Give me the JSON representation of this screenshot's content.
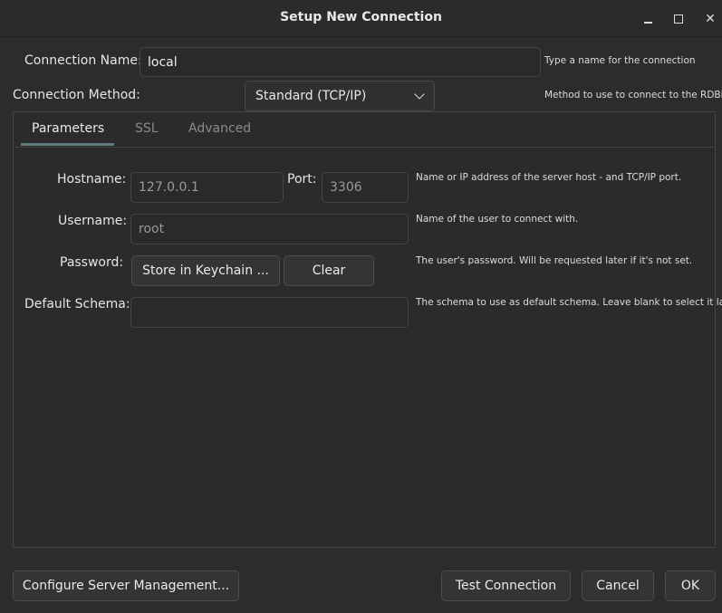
{
  "window": {
    "title": "Setup New Connection",
    "min_icon": "minimize-icon",
    "max_icon": "maximize-icon",
    "close_icon": "close-icon"
  },
  "connection": {
    "name_label": "Connection Name:",
    "name_value": "local",
    "name_hint": "Type a name for the connection",
    "method_label": "Connection Method:",
    "method_value": "Standard (TCP/IP)",
    "method_hint": "Method to use to connect to the RDBMS"
  },
  "tabs": [
    {
      "label": "Parameters",
      "active": true
    },
    {
      "label": "SSL",
      "active": false
    },
    {
      "label": "Advanced",
      "active": false
    }
  ],
  "parameters": {
    "hostname_label": "Hostname:",
    "hostname_value": "127.0.0.1",
    "port_label": "Port:",
    "port_value": "3306",
    "hostname_hint": "Name or IP address of the server host - and TCP/IP port.",
    "username_label": "Username:",
    "username_value": "root",
    "username_hint": "Name of the user to connect with.",
    "password_label": "Password:",
    "store_keychain_label": "Store in Keychain ...",
    "clear_label": "Clear",
    "password_hint": "The user's password. Will be requested later if it's not set.",
    "schema_label": "Default Schema:",
    "schema_value": "",
    "schema_hint": "The schema to use as default schema. Leave blank to select it later."
  },
  "footer": {
    "configure_label": "Configure Server Management...",
    "test_label": "Test Connection",
    "cancel_label": "Cancel",
    "ok_label": "OK"
  },
  "colors": {
    "background": "#2c2c2c",
    "tab_accent": "#5e7a7e"
  }
}
